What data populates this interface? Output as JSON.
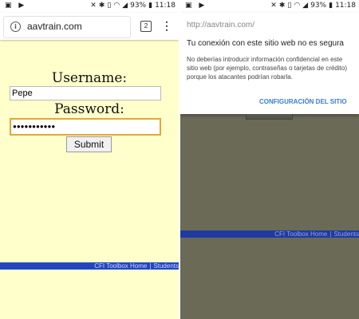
{
  "status_bar": {
    "left_icons": "▣ ▶",
    "battery_percent": "93%",
    "time": "11:18",
    "icons": [
      "sound-off-icon",
      "bluetooth-icon",
      "vibrate-icon",
      "nfc-icon",
      "wifi-icon",
      "signal-icon",
      "battery-icon"
    ]
  },
  "left_screen": {
    "url": "aavtrain.com",
    "tab_count": "2",
    "form": {
      "username_label": "Username:",
      "username_value": "Pepe",
      "password_label": "Password:",
      "password_value": "●●●●●●●●●●●",
      "submit_label": "Submit"
    },
    "footer": {
      "link1": "CFI Toolbox Home",
      "separator": "|",
      "link2": "Students"
    }
  },
  "right_screen": {
    "popup": {
      "url": "http://aavtrain.com/",
      "title": "Tu conexión con este sitio web no es segura",
      "description": "No deberías introducir información confidencial en este sitio web (por ejemplo, contraseñas o tarjetas de crédito) porque los atacantes podrían robarla.",
      "settings_link": "CONFIGURACIÓN DEL SITIO"
    },
    "footer": {
      "link1": "CFI Toolbox Home",
      "separator": "|",
      "link2": "Students"
    }
  },
  "colors": {
    "page_background": "#ffffcc",
    "dimmed_background": "#6b6a57",
    "footer_bar": "#2346c0",
    "link_accent": "#3b7bd6",
    "focus_border": "#e3a73a"
  }
}
